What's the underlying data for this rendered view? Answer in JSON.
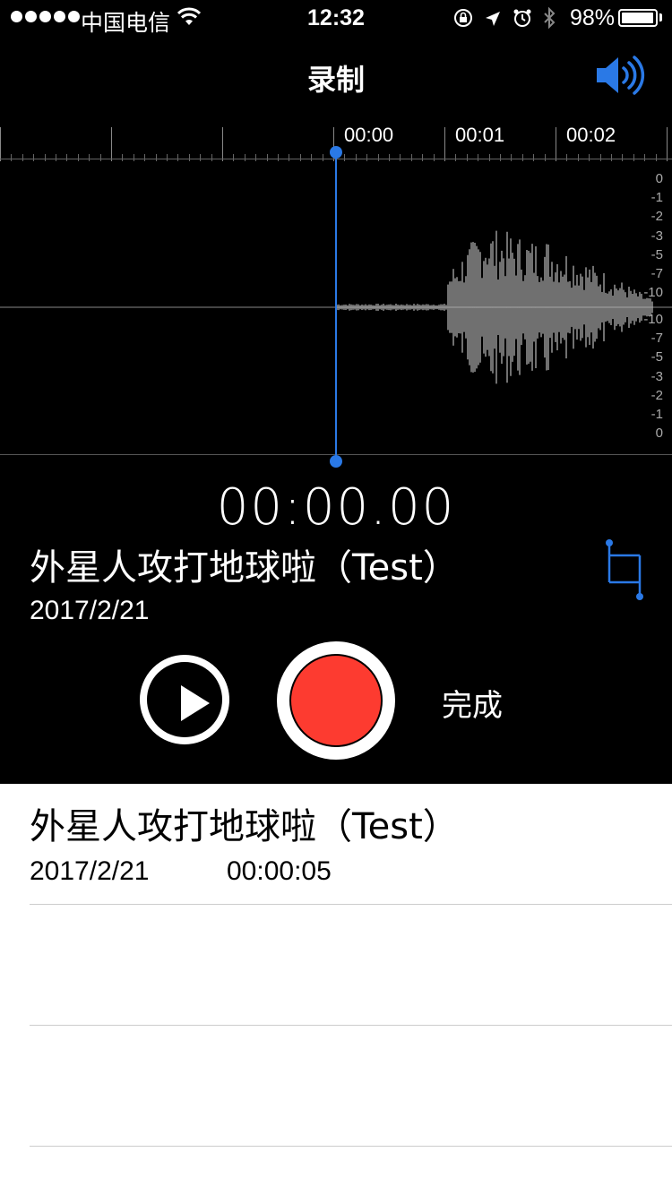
{
  "status_bar": {
    "carrier": "中国电信",
    "time": "12:32",
    "battery_percent": "98%",
    "battery_level": 0.98,
    "signal_bars": 5,
    "icons": [
      "wifi-icon",
      "rotation-lock-icon",
      "location-arrow-icon",
      "alarm-icon",
      "bluetooth-icon",
      "battery-icon"
    ]
  },
  "nav": {
    "title": "录制",
    "speaker_icon": "speaker-icon"
  },
  "timeline": {
    "labels": [
      "00:00",
      "00:01",
      "00:02"
    ]
  },
  "waveform": {
    "db_labels_top": [
      "0",
      "-1",
      "-2",
      "-3",
      "-5",
      "-7",
      "-10"
    ],
    "db_labels_bottom": [
      "-10",
      "-7",
      "-5",
      "-3",
      "-2",
      "-1",
      "0"
    ]
  },
  "recording": {
    "timer": "00:00.00",
    "title": "外星人攻打地球啦（Test）",
    "date": "2017/2/21",
    "trim_icon": "trim-icon"
  },
  "controls": {
    "play_icon": "play-icon",
    "record_icon": "record-icon",
    "done_label": "完成"
  },
  "list": {
    "items": [
      {
        "title": "外星人攻打地球啦（Test）",
        "date": "2017/2/21",
        "duration": "00:00:05"
      }
    ]
  },
  "colors": {
    "accent": "#2a79e6",
    "record": "#fd3b30",
    "background_dark": "#000000",
    "background_light": "#ffffff"
  }
}
